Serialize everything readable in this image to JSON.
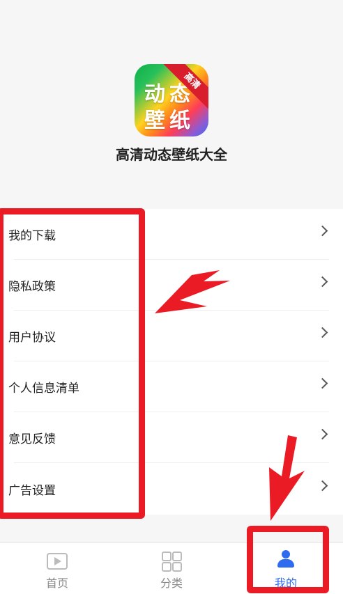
{
  "app": {
    "name": "高清动态壁纸大全",
    "logo_line1": "动态",
    "logo_line2": "壁纸",
    "logo_badge": "高清"
  },
  "menu": {
    "items": [
      {
        "label": "我的下载"
      },
      {
        "label": "隐私政策"
      },
      {
        "label": "用户协议"
      },
      {
        "label": "个人信息清单"
      },
      {
        "label": "意见反馈"
      },
      {
        "label": "广告设置"
      }
    ]
  },
  "tabbar": {
    "tabs": [
      {
        "label": "首页",
        "icon": "play-icon",
        "active": false
      },
      {
        "label": "分类",
        "icon": "grid-icon",
        "active": false
      },
      {
        "label": "我的",
        "icon": "user-icon",
        "active": true
      }
    ]
  },
  "colors": {
    "accent": "#2e6bf0",
    "annotation": "#ea1b24"
  }
}
